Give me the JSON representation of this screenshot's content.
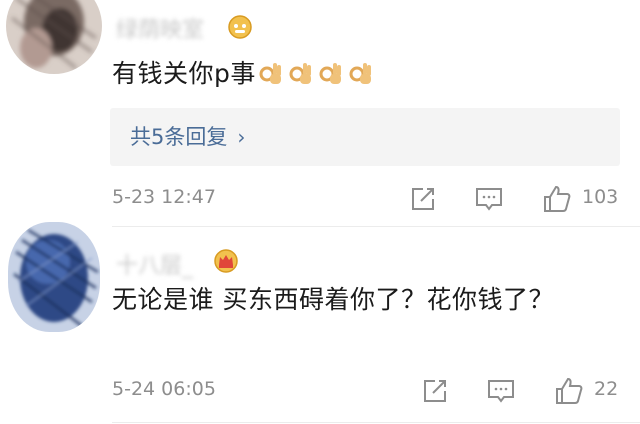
{
  "comments": [
    {
      "username": "绿荫映室",
      "badge_icon": "vip-badge-icon",
      "text": "有钱关你p事",
      "emoji_icon": "ok-hand-icon",
      "emoji_count": 4,
      "replies_label": "共5条回复",
      "timestamp": "5-23 12:47",
      "like_count": "103"
    },
    {
      "username": "十八层_",
      "badge_icon": "crown-badge-icon",
      "text": "无论是谁  买东西碍着你了？花你钱了？",
      "timestamp": "5-24 06:05",
      "like_count": "22"
    }
  ],
  "colors": {
    "link_blue": "#4a6c97",
    "meta_gray": "#8d8d8d",
    "reply_bg": "#f4f4f4",
    "badge_gold": "#e8b33a"
  }
}
